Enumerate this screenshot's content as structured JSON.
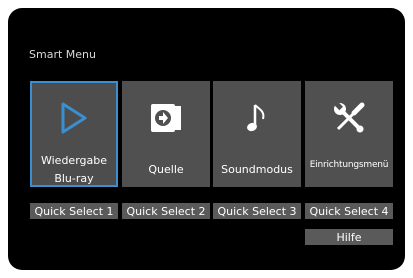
{
  "menu": {
    "title": "Smart Menu",
    "tiles": [
      {
        "label_line1": "Wiedergabe",
        "label_line2": "Blu-ray",
        "icon": "play-icon",
        "selected": true
      },
      {
        "label": "Quelle",
        "icon": "source-input-icon"
      },
      {
        "label": "Soundmodus",
        "icon": "music-note-icon"
      },
      {
        "label": "Einrichtungsmenü",
        "icon": "tools-icon"
      }
    ],
    "quick_select": [
      "Quick Select 1",
      "Quick Select 2",
      "Quick Select 3",
      "Quick Select 4"
    ],
    "help_label": "Hilfe"
  },
  "colors": {
    "background": "#000000",
    "tile": "#505050",
    "selected_border": "#3a8fd0",
    "button": "#5a5a5a",
    "text": "#ffffff"
  }
}
